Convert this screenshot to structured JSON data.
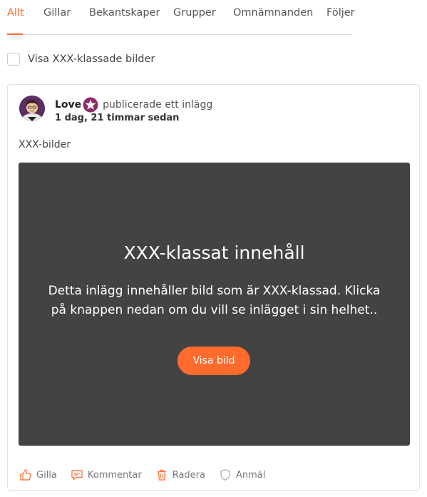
{
  "tabs": [
    {
      "label": "Allt",
      "active": true
    },
    {
      "label": "Gillar"
    },
    {
      "label": "Bekantskaper"
    },
    {
      "label": "Grupper"
    },
    {
      "label": "Omnämnanden"
    },
    {
      "label": "Följer"
    }
  ],
  "filter": {
    "label": "Visa XXX-klassade bilder",
    "checked": false
  },
  "post": {
    "author": "Love",
    "badge_icon": "star-badge-icon",
    "action_text": "publicerade ett inlägg",
    "timestamp": "1 dag, 21 timmar sedan",
    "text": "XXX-bilder",
    "nsfw": {
      "title": "XXX-klassat innehåll",
      "description": "Detta inlägg innehåller bild som är XXX-klassad. Klicka på knappen nedan om du vill se inlägget i sin helhet..",
      "button_label": "Visa bild"
    },
    "actions": [
      {
        "label": "Gilla",
        "icon": "thumbs-up-icon"
      },
      {
        "label": "Kommentar",
        "icon": "comment-icon"
      },
      {
        "label": "Radera",
        "icon": "trash-icon"
      },
      {
        "label": "Anmäl",
        "icon": "shield-icon"
      }
    ]
  },
  "colors": {
    "accent": "#ff6a2d",
    "overlay": "#434343",
    "badge": "#8b2b6a"
  }
}
